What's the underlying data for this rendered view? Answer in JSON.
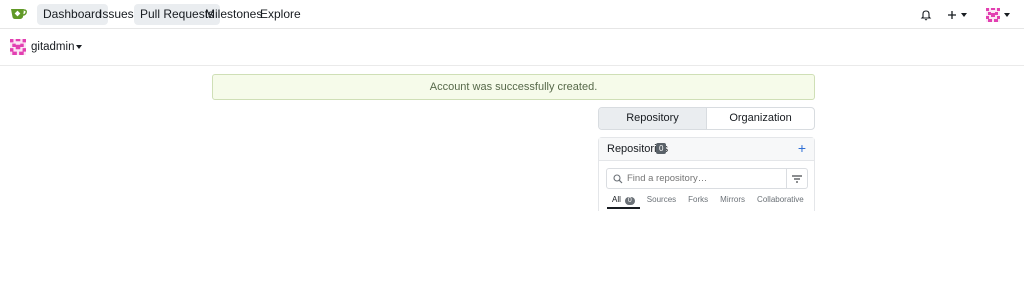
{
  "nav": {
    "items": [
      {
        "label": "Dashboard"
      },
      {
        "label": "Issues"
      },
      {
        "label": "Pull Requests"
      },
      {
        "label": "Milestones"
      },
      {
        "label": "Explore"
      }
    ]
  },
  "context": {
    "username": "gitadmin"
  },
  "flash": {
    "message": "Account was successfully created."
  },
  "switch": {
    "repository": "Repository",
    "organization": "Organization"
  },
  "repos": {
    "title": "Repositories",
    "count": "0",
    "search_placeholder": "Find a repository…",
    "tabs": [
      {
        "label": "All",
        "count": "0"
      },
      {
        "label": "Sources"
      },
      {
        "label": "Forks"
      },
      {
        "label": "Mirrors"
      },
      {
        "label": "Collaborative"
      }
    ]
  },
  "colors": {
    "accent": "#609926",
    "flash_bg": "#f6fbea",
    "link": "#2f6fd6"
  }
}
